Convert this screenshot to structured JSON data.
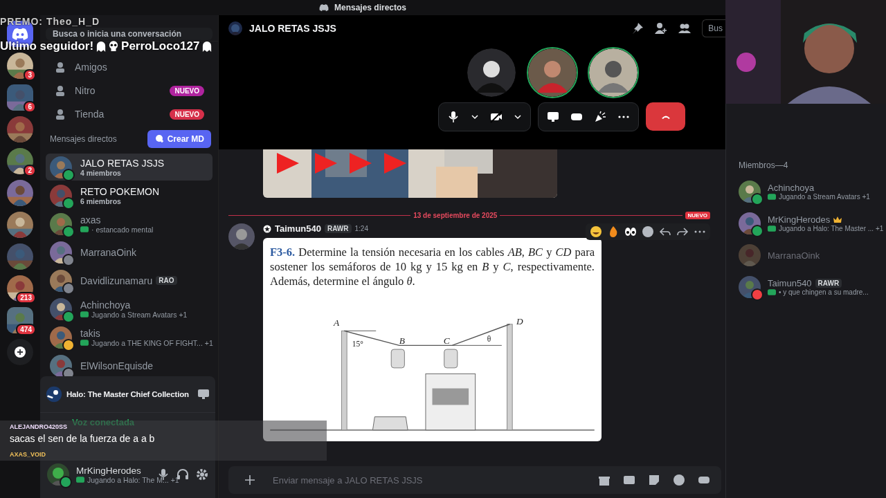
{
  "top_bar": {
    "title": "Mensajes directos"
  },
  "servers": [
    {
      "kind": "home"
    },
    {
      "kind": "avatar",
      "badge": "3"
    },
    {
      "kind": "folder",
      "badge": "6"
    },
    {
      "kind": "avatar"
    },
    {
      "kind": "avatar",
      "badge": "2"
    },
    {
      "kind": "avatar"
    },
    {
      "kind": "avatar"
    },
    {
      "kind": "avatar"
    },
    {
      "kind": "avatar",
      "badge": "213"
    },
    {
      "kind": "folder",
      "badge": "474"
    },
    {
      "kind": "add"
    }
  ],
  "search": {
    "placeholder": "Busca o inicia una conversación"
  },
  "nav": [
    {
      "label": "Amigos"
    },
    {
      "label": "Nitro",
      "badge": "NUEVO",
      "color": "#b0249f"
    },
    {
      "label": "Tienda",
      "badge": "NUEVO",
      "color": "#d6304a"
    }
  ],
  "dm_header": "Mensajes directos",
  "create_button": "Crear MD",
  "dms": [
    {
      "name": "JALO RETAS JSJS",
      "sub": "4 miembros",
      "selected": true,
      "color": "#23a55a",
      "kind": "group"
    },
    {
      "name": "RETO POKEMON",
      "sub": "6 miembros",
      "selected": false,
      "color": "#23a55a",
      "kind": "group"
    },
    {
      "name": "axas",
      "sub": "· estancado mental",
      "selected": false,
      "color": "#23a55a",
      "kind": "game"
    },
    {
      "name": "MarranaOink",
      "selected": false,
      "color": "#80848e",
      "kind": "user"
    },
    {
      "name": "Davidlizunamaru",
      "tag": "RAO",
      "selected": false,
      "color": "#80848e",
      "kind": "user"
    },
    {
      "name": "Achinchoya",
      "sub": "Jugando a Stream Avatars +1",
      "selected": false,
      "color": "#23a55a",
      "kind": "game"
    },
    {
      "name": "takis",
      "sub": "Jugando a THE KING OF FIGHT...  +1",
      "selected": false,
      "color": "#f0b232",
      "kind": "game"
    },
    {
      "name": "ElWilsonEquisde",
      "selected": false,
      "color": "#80848e",
      "kind": "user"
    }
  ],
  "activity": {
    "title": "Halo: The Master Chief Collection"
  },
  "voice": {
    "label": "Voz conectada"
  },
  "user_panel": {
    "name": "MrKingHerodes",
    "sub": "Jugando a Halo: The M... +1"
  },
  "channel": {
    "name": "JALO RETAS JSJS",
    "search": "Bus"
  },
  "call": {
    "participants": [
      {
        "speaking": false
      },
      {
        "speaking": true
      },
      {
        "speaking": true
      }
    ]
  },
  "chat": {
    "date": "13 de septiembre de 2025",
    "new_label": "NUEVO",
    "message": {
      "author": "Taimun540",
      "tag": "RAWR",
      "time": "1:24",
      "problem": "**F3-6.**  Determine la tensión necesaria en los cables *AB*, *BC* y *CD* para sostener los semáforos de 10 kg y 15 kg en *B* y *C*, respectivamente. Además, determine el ángulo *θ*.",
      "diagram_labels": [
        "A",
        "B",
        "C",
        "D",
        "15°",
        "θ"
      ]
    }
  },
  "composer": {
    "placeholder": "Enviar mensaje a JALO RETAS JSJS"
  },
  "members": {
    "header": "Miembros—4",
    "items": [
      {
        "name": "Achinchoya",
        "sub": "Jugando a Stream Avatars +1",
        "color": "#23a55a",
        "dim": false
      },
      {
        "name": "MrKingHerodes",
        "sub": "Jugando a Halo: The Master ... +1",
        "color": "#23a55a",
        "dim": false,
        "owner": true
      },
      {
        "name": "MarranaOink",
        "dim": true
      },
      {
        "name": "Taimun540",
        "tag": "RAWR",
        "sub": "• y que chingen a su madre...",
        "color": "#f23f43",
        "dim": false
      }
    ]
  },
  "stream_overlay": {
    "premo": "PREMO: Theo_H_D",
    "follower_label": "Ultimo seguidor!",
    "follower_name": "PerroLoco127",
    "chat": [
      {
        "user": "ALEJANDRO420SS",
        "text": "sacas el sen de la fuerza de a a b"
      },
      {
        "user": "AXAS_VOID"
      }
    ]
  }
}
